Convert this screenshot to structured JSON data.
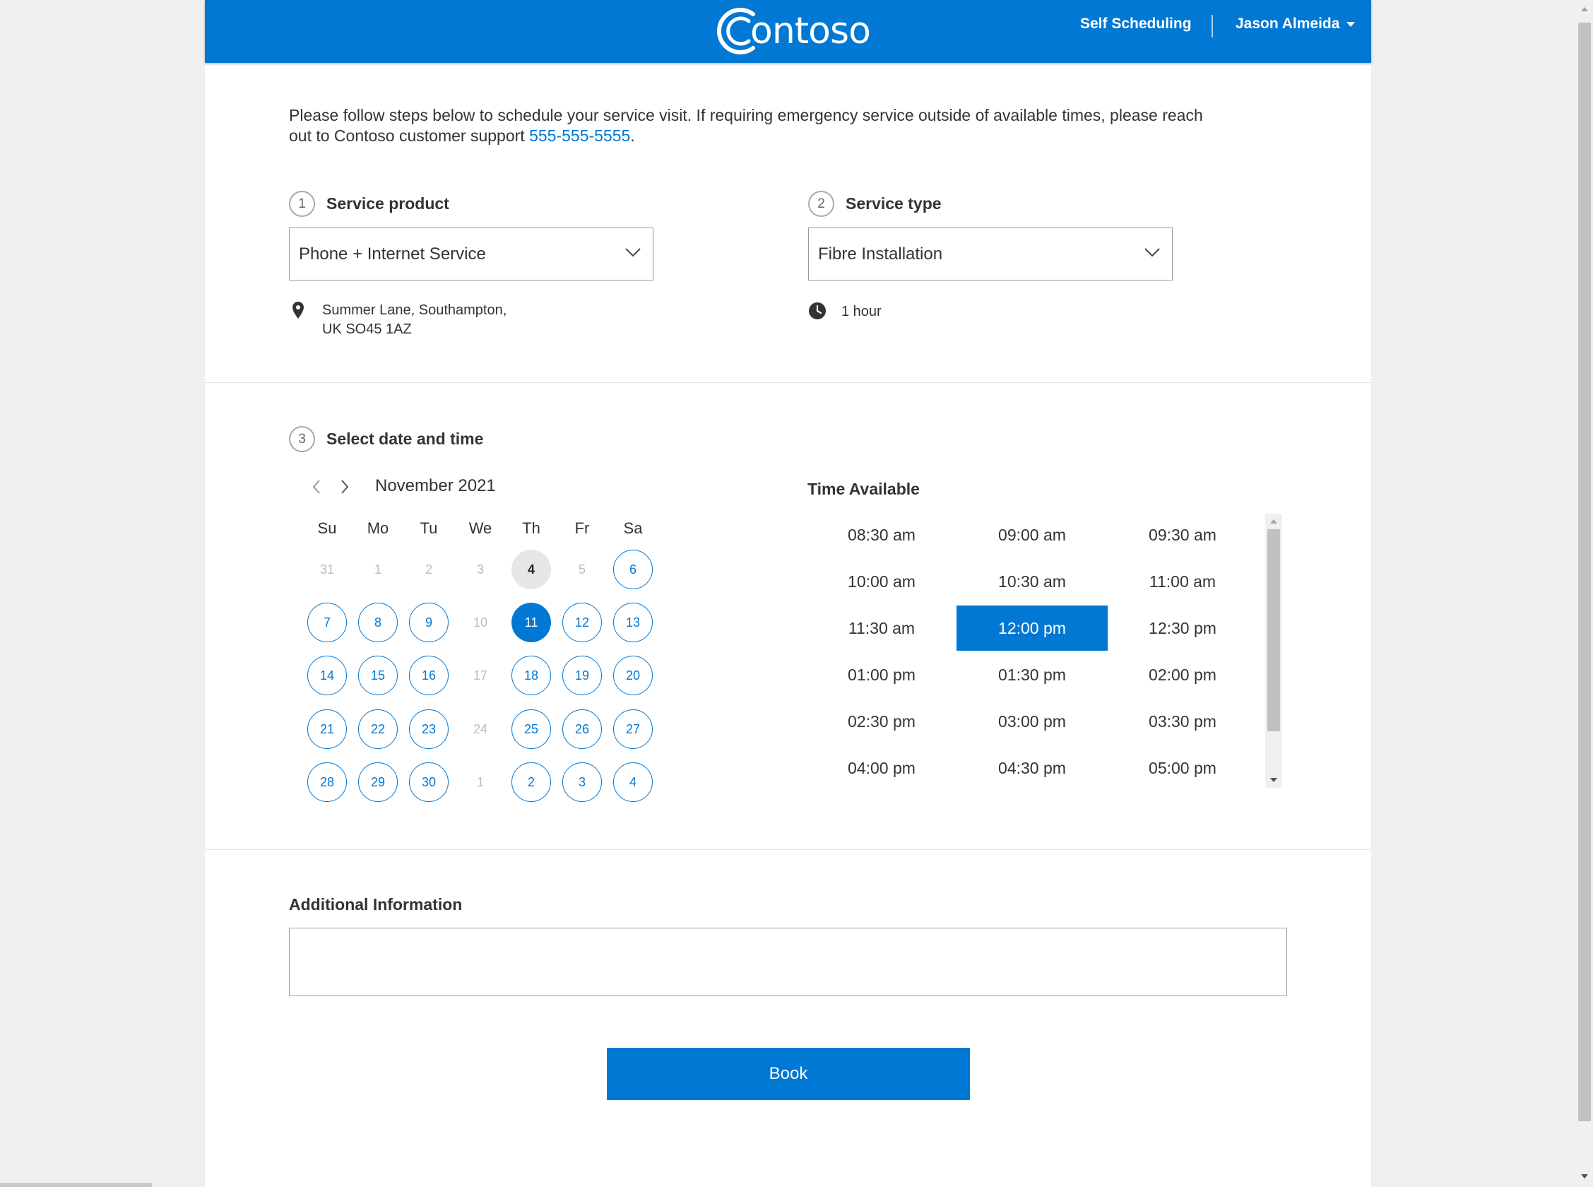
{
  "header": {
    "logo_text": "ontoso",
    "nav_link": "Self Scheduling",
    "user_name": "Jason Almeida"
  },
  "intro": {
    "text_before": "Please follow steps below to schedule your service visit. If requiring emergency service outside of available times, please reach out to Contoso customer support ",
    "phone": "555-555-5555",
    "text_after": "."
  },
  "step1": {
    "number": "1",
    "label": "Service product",
    "selected": "Phone + Internet Service",
    "address_line1": "Summer Lane, Southampton,",
    "address_line2": "UK SO45 1AZ"
  },
  "step2": {
    "number": "2",
    "label": "Service type",
    "selected": "Fibre Installation",
    "duration": "1 hour"
  },
  "step3": {
    "number": "3",
    "label": "Select date and time",
    "month": "November 2021",
    "weekdays": [
      "Su",
      "Mo",
      "Tu",
      "We",
      "Th",
      "Fr",
      "Sa"
    ],
    "days": [
      {
        "label": "31",
        "state": "dim"
      },
      {
        "label": "1",
        "state": "dim"
      },
      {
        "label": "2",
        "state": "dim"
      },
      {
        "label": "3",
        "state": "dim"
      },
      {
        "label": "4",
        "state": "today"
      },
      {
        "label": "5",
        "state": "dim"
      },
      {
        "label": "6",
        "state": "avail"
      },
      {
        "label": "7",
        "state": "avail"
      },
      {
        "label": "8",
        "state": "avail"
      },
      {
        "label": "9",
        "state": "avail"
      },
      {
        "label": "10",
        "state": "dim"
      },
      {
        "label": "11",
        "state": "sel"
      },
      {
        "label": "12",
        "state": "avail"
      },
      {
        "label": "13",
        "state": "avail"
      },
      {
        "label": "14",
        "state": "avail"
      },
      {
        "label": "15",
        "state": "avail"
      },
      {
        "label": "16",
        "state": "avail"
      },
      {
        "label": "17",
        "state": "dim"
      },
      {
        "label": "18",
        "state": "avail"
      },
      {
        "label": "19",
        "state": "avail"
      },
      {
        "label": "20",
        "state": "avail"
      },
      {
        "label": "21",
        "state": "avail"
      },
      {
        "label": "22",
        "state": "avail"
      },
      {
        "label": "23",
        "state": "avail"
      },
      {
        "label": "24",
        "state": "dim"
      },
      {
        "label": "25",
        "state": "avail"
      },
      {
        "label": "26",
        "state": "avail"
      },
      {
        "label": "27",
        "state": "avail"
      },
      {
        "label": "28",
        "state": "avail"
      },
      {
        "label": "29",
        "state": "avail"
      },
      {
        "label": "30",
        "state": "avail"
      },
      {
        "label": "1",
        "state": "dim"
      },
      {
        "label": "2",
        "state": "avail"
      },
      {
        "label": "3",
        "state": "avail"
      },
      {
        "label": "4",
        "state": "avail"
      }
    ],
    "time_title": "Time Available",
    "times": [
      "08:30 am",
      "09:00 am",
      "09:30 am",
      "10:00 am",
      "10:30 am",
      "11:00 am",
      "11:30 am",
      "12:00 pm",
      "12:30 pm",
      "01:00 pm",
      "01:30 pm",
      "02:00 pm",
      "02:30 pm",
      "03:00 pm",
      "03:30 pm",
      "04:00 pm",
      "04:30 pm",
      "05:00 pm"
    ],
    "selected_time": "12:00 pm"
  },
  "additional": {
    "label": "Additional Information",
    "value": ""
  },
  "book_label": "Book",
  "colors": {
    "accent": "#0078d4",
    "dim_text": "#bbbbbb"
  }
}
